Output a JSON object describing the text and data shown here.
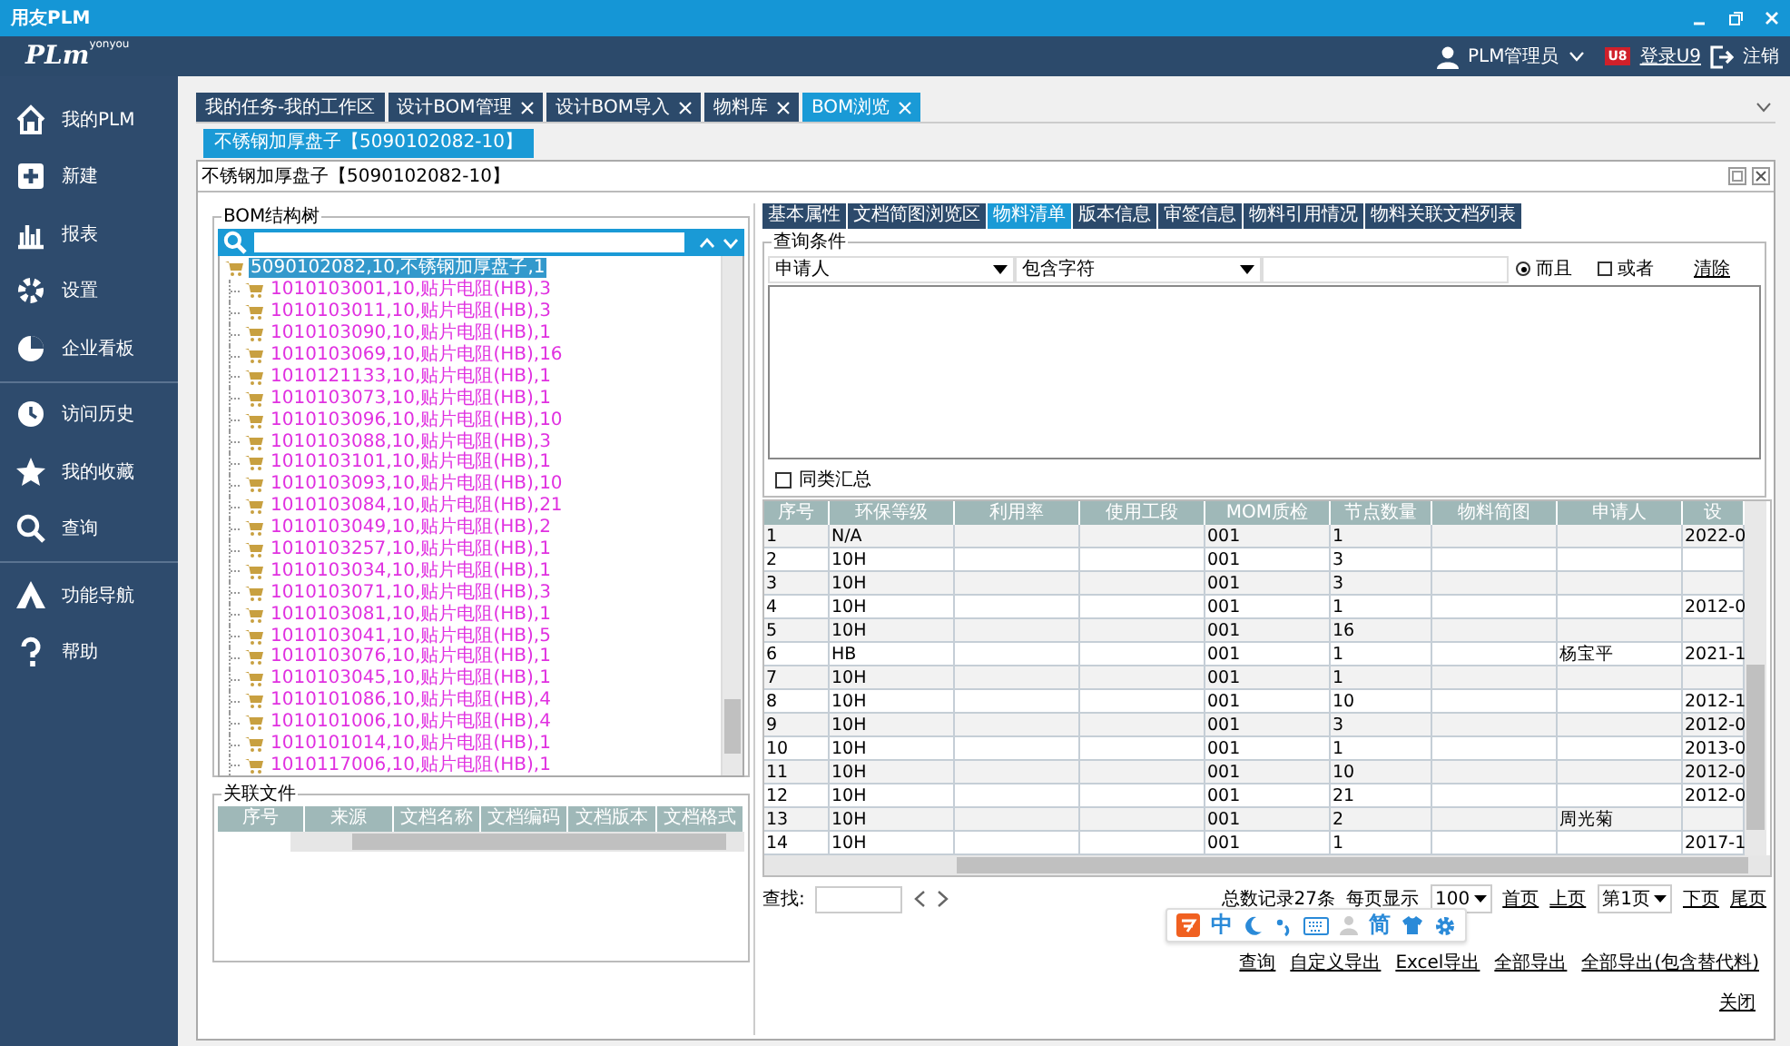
{
  "window": {
    "title": "用友PLM"
  },
  "header": {
    "logo": "PLm",
    "logo_sup": "yonyou",
    "user": "PLM管理员",
    "badge": "U8",
    "login": "登录U9",
    "logout": "注销"
  },
  "sidebar": {
    "groups": [
      [
        {
          "label": "我的PLM"
        },
        {
          "label": "新建"
        },
        {
          "label": "报表"
        },
        {
          "label": "设置"
        },
        {
          "label": "企业看板"
        }
      ],
      [
        {
          "label": "访问历史"
        },
        {
          "label": "我的收藏"
        },
        {
          "label": "查询"
        }
      ],
      [
        {
          "label": "功能导航"
        },
        {
          "label": "帮助"
        }
      ]
    ]
  },
  "tabs": [
    {
      "label": "我的任务-我的工作区",
      "selected": false,
      "closable": false
    },
    {
      "label": "设计BOM管理",
      "selected": false,
      "closable": true
    },
    {
      "label": "设计BOM导入",
      "selected": false,
      "closable": true
    },
    {
      "label": "物料库",
      "selected": false,
      "closable": true
    },
    {
      "label": "BOM浏览",
      "selected": true,
      "closable": true
    }
  ],
  "subtabs": [
    {
      "label": "不锈钢加厚盘子【5090102082-10】",
      "selected": true
    }
  ],
  "panel": {
    "title": "不锈钢加厚盘子【5090102082-10】"
  },
  "bom_tree": {
    "legend": "BOM结构树",
    "items": [
      {
        "label": "5090102082,10,不锈钢加厚盘子,1",
        "selected": true,
        "children": [
          {
            "label": "1010103001,10,贴片电阻(HB),3",
            "selected": false
          },
          {
            "label": "1010103011,10,贴片电阻(HB),3",
            "selected": false
          },
          {
            "label": "1010103090,10,贴片电阻(HB),1",
            "selected": false
          },
          {
            "label": "1010103069,10,贴片电阻(HB),16",
            "selected": false
          },
          {
            "label": "1010121133,10,贴片电阻(HB),1",
            "selected": false
          },
          {
            "label": "1010103073,10,贴片电阻(HB),1",
            "selected": false
          },
          {
            "label": "1010103096,10,贴片电阻(HB),10",
            "selected": false
          },
          {
            "label": "1010103088,10,贴片电阻(HB),3",
            "selected": false
          },
          {
            "label": "1010103101,10,贴片电阻(HB),1",
            "selected": false
          },
          {
            "label": "1010103093,10,贴片电阻(HB),10",
            "selected": false
          },
          {
            "label": "1010103084,10,贴片电阻(HB),21",
            "selected": false
          },
          {
            "label": "1010103049,10,贴片电阻(HB),2",
            "selected": false
          },
          {
            "label": "1010103257,10,贴片电阻(HB),1",
            "selected": false
          },
          {
            "label": "1010103034,10,贴片电阻(HB),1",
            "selected": false
          },
          {
            "label": "1010103071,10,贴片电阻(HB),3",
            "selected": false
          },
          {
            "label": "1010103081,10,贴片电阻(HB),1",
            "selected": false
          },
          {
            "label": "1010103041,10,贴片电阻(HB),5",
            "selected": false
          },
          {
            "label": "1010103076,10,贴片电阻(HB),1",
            "selected": false
          },
          {
            "label": "1010103045,10,贴片电阻(HB),1",
            "selected": false
          },
          {
            "label": "1010101086,10,贴片电阻(HB),4",
            "selected": false
          },
          {
            "label": "1010101006,10,贴片电阻(HB),4",
            "selected": false
          },
          {
            "label": "1010101014,10,贴片电阻(HB),1",
            "selected": false
          },
          {
            "label": "1010117006,10,贴片电阻(HB),1",
            "selected": false
          }
        ]
      }
    ]
  },
  "related_files": {
    "legend": "关联文件",
    "columns": [
      "序号",
      "来源",
      "文档名称",
      "文档编码",
      "文档版本",
      "文档格式"
    ]
  },
  "detail_tabs": [
    {
      "label": "基本属性",
      "selected": false
    },
    {
      "label": "文档简图浏览区",
      "selected": false
    },
    {
      "label": "物料清单",
      "selected": true
    },
    {
      "label": "版本信息",
      "selected": false
    },
    {
      "label": "审签信息",
      "selected": false
    },
    {
      "label": "物料引用情况",
      "selected": false
    },
    {
      "label": "物料关联文档列表",
      "selected": false
    }
  ],
  "query": {
    "legend": "查询条件",
    "field": "申请人",
    "operator": "包含字符",
    "logic": [
      {
        "label": "而且",
        "selected": true
      },
      {
        "label": "或者",
        "selected": false
      }
    ],
    "clear": "清除",
    "group_summary": {
      "label": "同类汇总",
      "checked": false
    }
  },
  "table": {
    "columns": [
      "序号",
      "环保等级",
      "利用率",
      "使用工段",
      "MOM质检",
      "节点数量",
      "物料简图",
      "申请人",
      "设"
    ],
    "rows": [
      [
        "1",
        "N/A",
        "",
        "",
        "001",
        "1",
        "",
        "",
        "2022-0"
      ],
      [
        "2",
        "10H",
        "",
        "",
        "001",
        "3",
        "",
        "",
        ""
      ],
      [
        "3",
        "10H",
        "",
        "",
        "001",
        "3",
        "",
        "",
        ""
      ],
      [
        "4",
        "10H",
        "",
        "",
        "001",
        "1",
        "",
        "",
        "2012-0"
      ],
      [
        "5",
        "10H",
        "",
        "",
        "001",
        "16",
        "",
        "",
        ""
      ],
      [
        "6",
        "HB",
        "",
        "",
        "001",
        "1",
        "",
        "杨宝平",
        "2021-1"
      ],
      [
        "7",
        "10H",
        "",
        "",
        "001",
        "1",
        "",
        "",
        ""
      ],
      [
        "8",
        "10H",
        "",
        "",
        "001",
        "10",
        "",
        "",
        "2012-1"
      ],
      [
        "9",
        "10H",
        "",
        "",
        "001",
        "3",
        "",
        "",
        "2012-0"
      ],
      [
        "10",
        "10H",
        "",
        "",
        "001",
        "1",
        "",
        "",
        "2013-0"
      ],
      [
        "11",
        "10H",
        "",
        "",
        "001",
        "10",
        "",
        "",
        "2012-0"
      ],
      [
        "12",
        "10H",
        "",
        "",
        "001",
        "21",
        "",
        "",
        "2012-0"
      ],
      [
        "13",
        "10H",
        "",
        "",
        "001",
        "2",
        "",
        "周光菊",
        ""
      ],
      [
        "14",
        "10H",
        "",
        "",
        "001",
        "1",
        "",
        "",
        "2017-1"
      ]
    ]
  },
  "pager": {
    "find_label": "查找:",
    "total": "总数记录27条",
    "per_page_label": "每页显示",
    "per_page": "100",
    "first": "首页",
    "prev": "上页",
    "page": "第1页",
    "next": "下页",
    "last": "尾页"
  },
  "ime_toolbar": {
    "mode": "中",
    "script": "简"
  },
  "actions": [
    "查询",
    "自定义导出",
    "Excel导出",
    "全部导出",
    "全部导出(包含替代料)"
  ],
  "close": "关闭"
}
